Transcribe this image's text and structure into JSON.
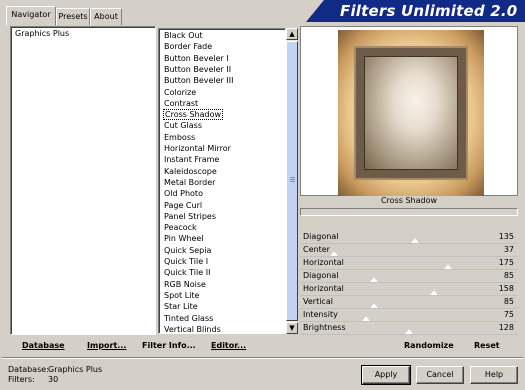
{
  "app_title": "Filters Unlimited 2.0",
  "tabs": [
    {
      "label": "Navigator",
      "active": true
    },
    {
      "label": "Presets",
      "active": false
    },
    {
      "label": "About",
      "active": false
    }
  ],
  "categories": [
    "Graphics Plus"
  ],
  "filters": [
    {
      "label": "Black Out"
    },
    {
      "label": "Border Fade"
    },
    {
      "label": "Button Beveler I"
    },
    {
      "label": "Button Beveler II"
    },
    {
      "label": "Button Beveler III"
    },
    {
      "label": "Colorize"
    },
    {
      "label": "Contrast"
    },
    {
      "label": "Cross Shadow",
      "selected": true
    },
    {
      "label": "Cut Glass"
    },
    {
      "label": "Emboss"
    },
    {
      "label": "Horizontal Mirror"
    },
    {
      "label": "Instant Frame"
    },
    {
      "label": "Kaleidoscope"
    },
    {
      "label": "Metal Border"
    },
    {
      "label": "Old Photo"
    },
    {
      "label": "Page Curl"
    },
    {
      "label": "Panel Stripes"
    },
    {
      "label": "Peacock"
    },
    {
      "label": "Pin Wheel"
    },
    {
      "label": "Quick Sepia"
    },
    {
      "label": "Quick Tile I"
    },
    {
      "label": "Quick Tile II"
    },
    {
      "label": "RGB Noise"
    },
    {
      "label": "Spot Lite"
    },
    {
      "label": "Star Lite"
    },
    {
      "label": "Tinted Glass"
    },
    {
      "label": "Vertical Blinds"
    }
  ],
  "preview": {
    "label": "Cross Shadow"
  },
  "sliders": [
    {
      "label": "Diagonal",
      "value": "135",
      "max": 255
    },
    {
      "label": "Center",
      "value": "37",
      "max": 255
    },
    {
      "label": "Horizontal",
      "value": "175",
      "max": 255
    },
    {
      "label": "Diagonal",
      "value": "85",
      "max": 255
    },
    {
      "label": "Horizontal",
      "value": "158",
      "max": 255
    },
    {
      "label": "Vertical",
      "value": "85",
      "max": 255
    },
    {
      "label": "Intensity",
      "value": "75",
      "max": 255
    },
    {
      "label": "Brightness",
      "value": "128",
      "max": 255
    }
  ],
  "toolbar": {
    "database": "Database",
    "import": "Import...",
    "filter_info": "Filter Info...",
    "editor": "Editor...",
    "randomize": "Randomize",
    "reset": "Reset"
  },
  "status": {
    "database_label": "Database:",
    "database_value": "Graphics Plus",
    "filters_label": "Filters:",
    "filters_value": "30"
  },
  "buttons": {
    "apply": "Apply",
    "cancel": "Cancel",
    "help": "Help"
  },
  "colors": {
    "banner": "#102a86",
    "scroll_thumb": "#c3d2f1",
    "window": "#d4d0c8"
  }
}
